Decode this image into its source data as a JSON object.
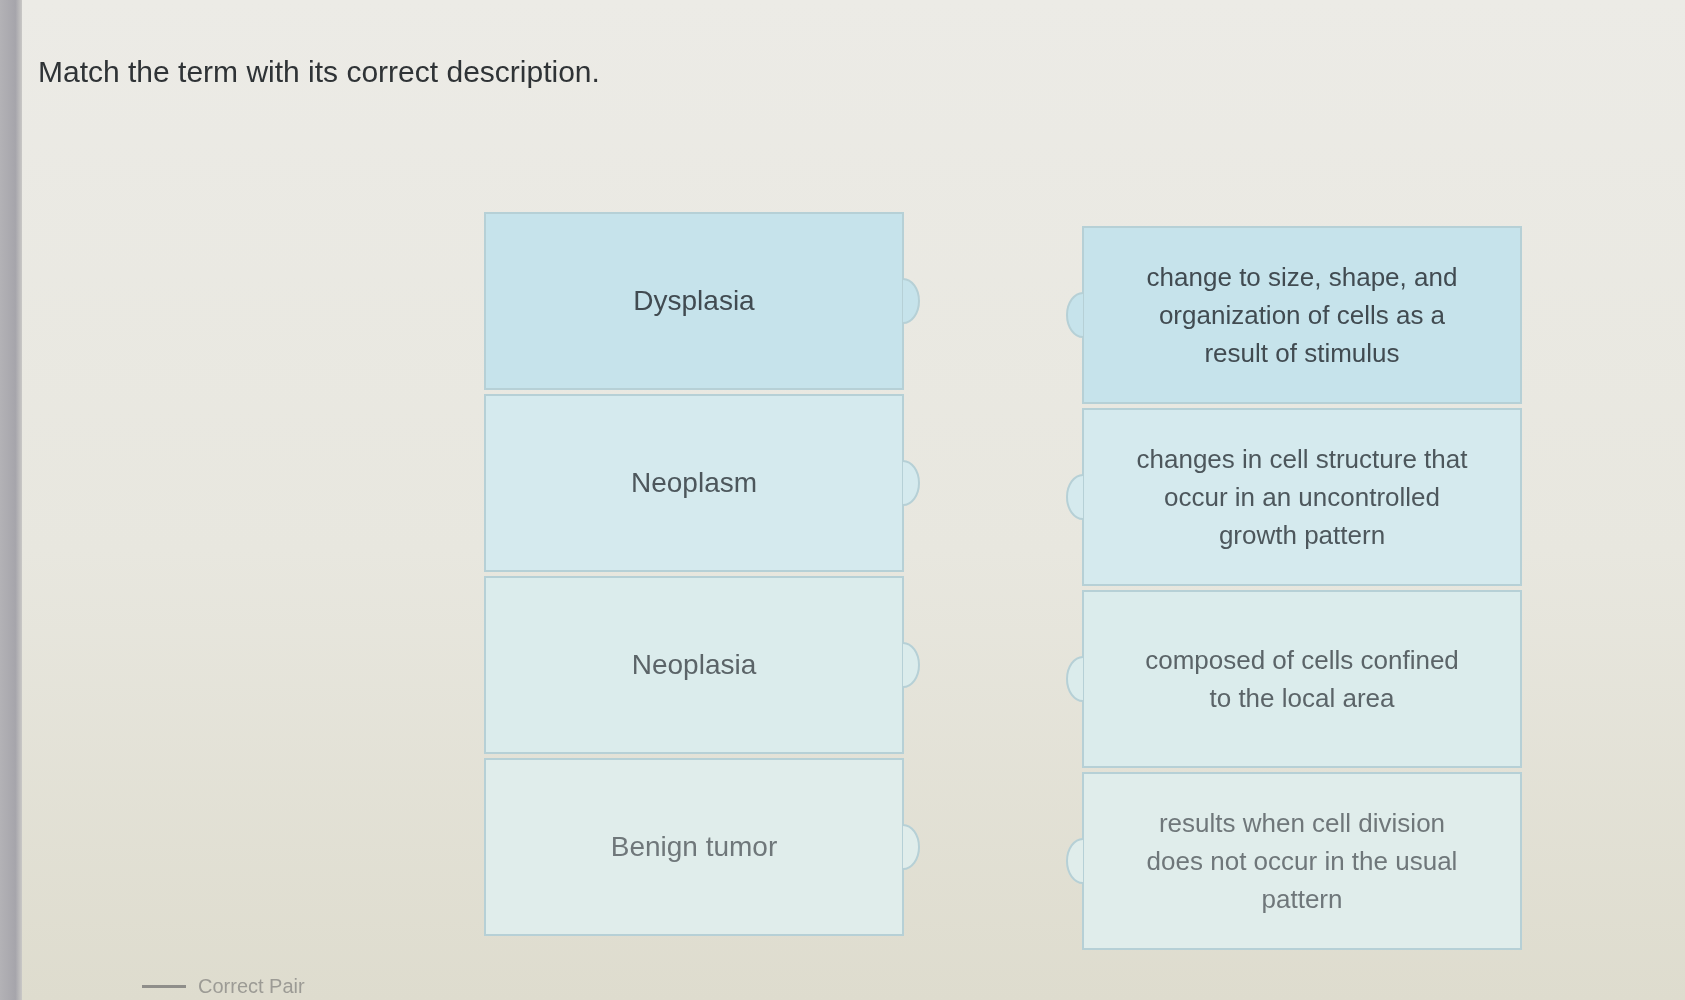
{
  "prompt": "Match the term with its correct description.",
  "terms": [
    "Dysplasia",
    "Neoplasm",
    "Neoplasia",
    "Benign tumor"
  ],
  "descriptions": [
    "change to size, shape, and\norganization of cells as a\nresult of stimulus",
    "changes in cell structure that\noccur in an uncontrolled\ngrowth pattern",
    "composed of cells confined\nto the local area",
    "results when cell division\ndoes not occur in the usual\npattern"
  ],
  "legend": {
    "label": "Correct Pair"
  }
}
